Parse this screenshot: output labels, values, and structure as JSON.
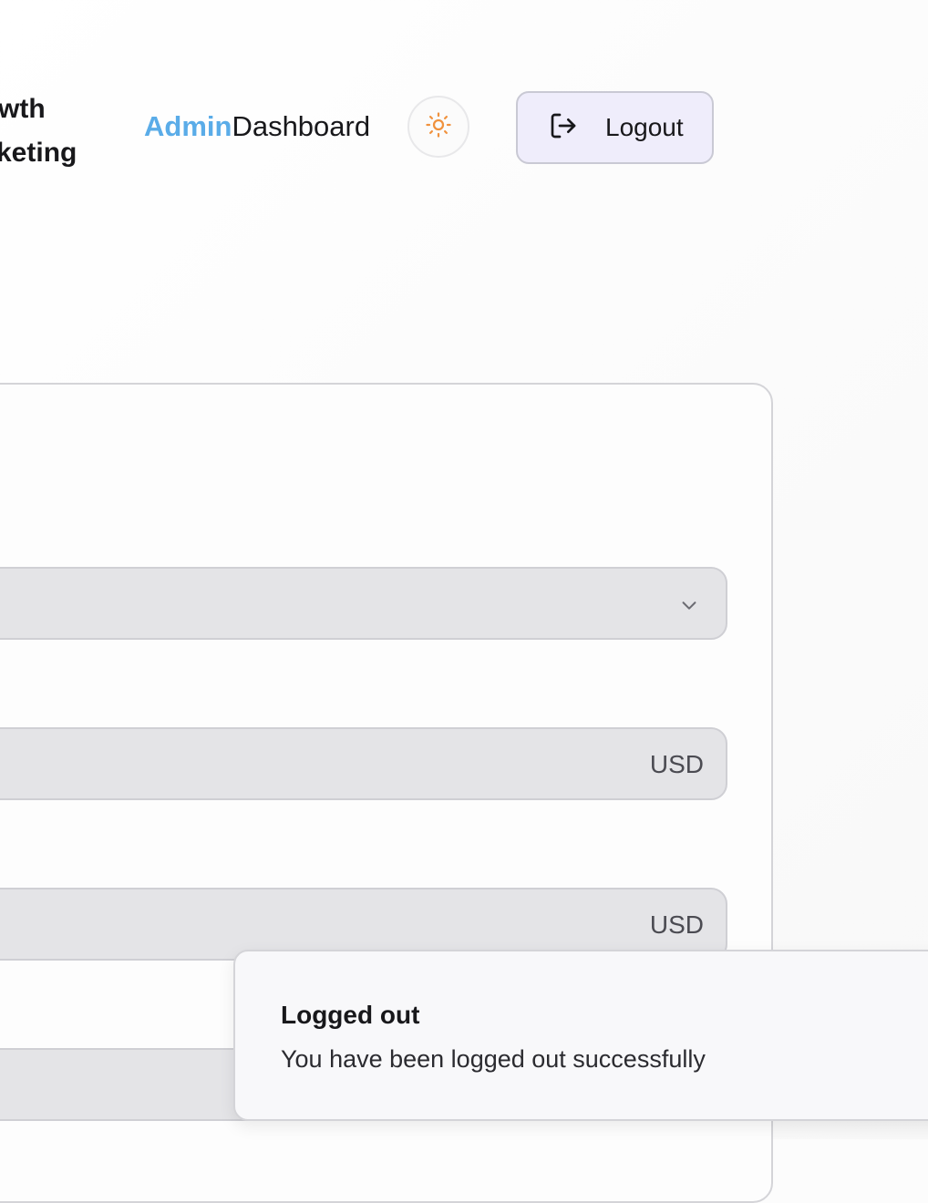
{
  "header": {
    "brand_line1": "wth",
    "brand_line2": "keting",
    "title_accent": "Admin",
    "title_rest": "Dashboard",
    "theme_icon": "sun-icon",
    "logout_icon": "logout-icon",
    "logout_label": "Logout"
  },
  "form": {
    "select_icon": "chevron-down-icon",
    "amount1_suffix": "USD",
    "amount2_suffix": "USD"
  },
  "toast": {
    "title": "Logged out",
    "description": "You have been logged out successfully"
  },
  "colors": {
    "accent": "#5aace8",
    "sun": "#f0923e",
    "logout_bg": "#efedfb",
    "field_bg": "#e4e4e7"
  }
}
